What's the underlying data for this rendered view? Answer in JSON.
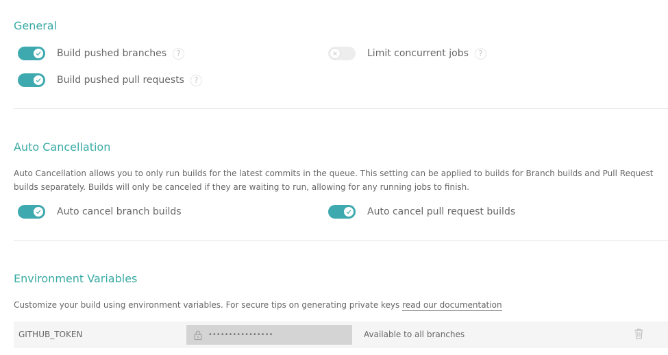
{
  "general": {
    "title": "General",
    "settings": {
      "build_pushed_branches": {
        "label": "Build pushed branches",
        "enabled": true
      },
      "build_pushed_pull_requests": {
        "label": "Build pushed pull requests",
        "enabled": true
      },
      "limit_concurrent_jobs": {
        "label": "Limit concurrent jobs",
        "enabled": false
      }
    },
    "help_glyph": "?"
  },
  "auto_cancellation": {
    "title": "Auto Cancellation",
    "description": "Auto Cancellation allows you to only run builds for the latest commits in the queue. This setting can be applied to builds for Branch builds and Pull Request builds separately. Builds will only be canceled if they are waiting to run, allowing for any running jobs to finish.",
    "settings": {
      "auto_cancel_branch_builds": {
        "label": "Auto cancel branch builds",
        "enabled": true
      },
      "auto_cancel_pull_request_builds": {
        "label": "Auto cancel pull request builds",
        "enabled": true
      }
    }
  },
  "environment_variables": {
    "title": "Environment Variables",
    "description": "Customize your build using environment variables. For secure tips on generating private keys",
    "doc_link": "read our documentation",
    "variables": [
      {
        "name": "GITHUB_TOKEN",
        "value_masked": "••••••••••••••••",
        "scope": "Available to all branches"
      }
    ]
  },
  "icons": {
    "toggle_on": "check-icon",
    "toggle_off": "x-icon",
    "help": "question-icon",
    "lock": "lock-icon",
    "delete": "trash-icon"
  },
  "colors": {
    "accent": "#39aaa4",
    "toggle_on": "#3eaaaf",
    "toggle_off": "#ededed",
    "text": "#666666",
    "row_bg": "#f5f5f5",
    "masked_field_bg": "#d4d4d4"
  }
}
